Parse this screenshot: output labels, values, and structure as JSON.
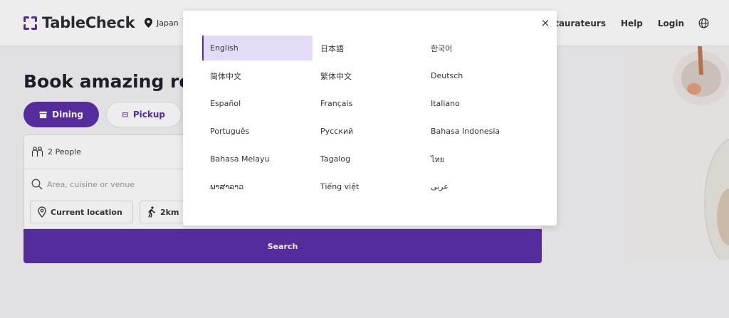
{
  "header": {
    "logo_text": "TableCheck",
    "region": "Japan",
    "nav": {
      "restaurateurs": "Restaurateurs",
      "help": "Help",
      "login": "Login"
    }
  },
  "hero": {
    "title": "Book amazing rest",
    "tabs": {
      "dining": "Dining",
      "pickup": "Pickup"
    }
  },
  "form": {
    "people": "2 People",
    "search_placeholder": "Area, cuisine or venue",
    "current_location": "Current location",
    "distance": "2km",
    "search_button": "Search"
  },
  "language_modal": {
    "close": "×",
    "selected": "English",
    "languages": [
      "English",
      "日本語",
      "한국어",
      "简体中文",
      "繁体中文",
      "Deutsch",
      "Español",
      "Français",
      "Italiano",
      "Português",
      "Русский",
      "Bahasa Indonesia",
      "Bahasa Melayu",
      "Tagalog",
      "ไทย",
      "ພາສາລາວ",
      "Tiếng việt",
      "عربى"
    ]
  },
  "colors": {
    "brand": "#5a2ea6",
    "selected_bg": "#e4dbf7"
  }
}
